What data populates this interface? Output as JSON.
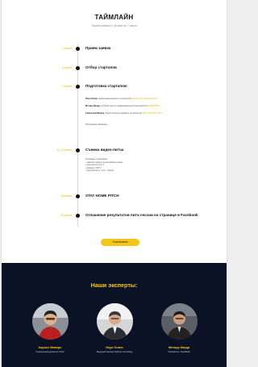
{
  "header": {
    "title": "ТАЙМЛАЙН",
    "subtitle": "Прием заявок с 18 мая по 7 июня"
  },
  "timeline": [
    {
      "date": "7 июня",
      "title": "Прием заявок"
    },
    {
      "date": "8 июня",
      "title": "Отбор стартапов"
    },
    {
      "date": "9 июня",
      "title": "Подготовка стартапов:",
      "mentors": [
        {
          "name": "Илья Олим",
          "text": "нейрокоммуникация и психология",
          "link": "конверсия бизнес-модели"
        },
        {
          "name": "Мотару Икада",
          "text": "Особый урок по информационной безопасности",
          "link": "КИБЕРБЕЗ"
        },
        {
          "name": "Семенова Марина",
          "text": "Какие вопросы задавать на демо-дне",
          "link": "КАК СКАЗАТЬ ПИТЧ"
        }
      ],
      "note": "Обучающие вебинары"
    },
    {
      "date": "11-12 июня",
      "title": "Съемка видео-питча",
      "intro": "Основные требования:",
      "requirements": [
        "записать видео на английском языке",
        "длительность 2-3",
        "формат: ПИТЧ",
        "деятельность: питч - проект"
      ]
    },
    {
      "date": "18 июня",
      "title": "STAY HOME PITCH"
    },
    {
      "date": "20 июня",
      "title": "Оглашение результатов питч-сессии на странице в Facebook"
    }
  ],
  "cta": {
    "label": "Участвовать"
  },
  "experts": {
    "title": "Наши эксперты:",
    "people": [
      {
        "name": "Хиросе Макиро",
        "role": "Генеральный директор JUSA",
        "avatar_color": "#b8201e"
      },
      {
        "name": "Икуо Огино",
        "role": "Ведущий партнер Skybyte Consulting",
        "avatar_color": "#e9e9e9"
      },
      {
        "name": "Мотару Икада",
        "role": "Основатель TrueMedia",
        "avatar_color": "#222222"
      }
    ]
  },
  "colors": {
    "accent": "#f5c518",
    "dark_bg": "#0c1226",
    "date": "#f0b400"
  }
}
